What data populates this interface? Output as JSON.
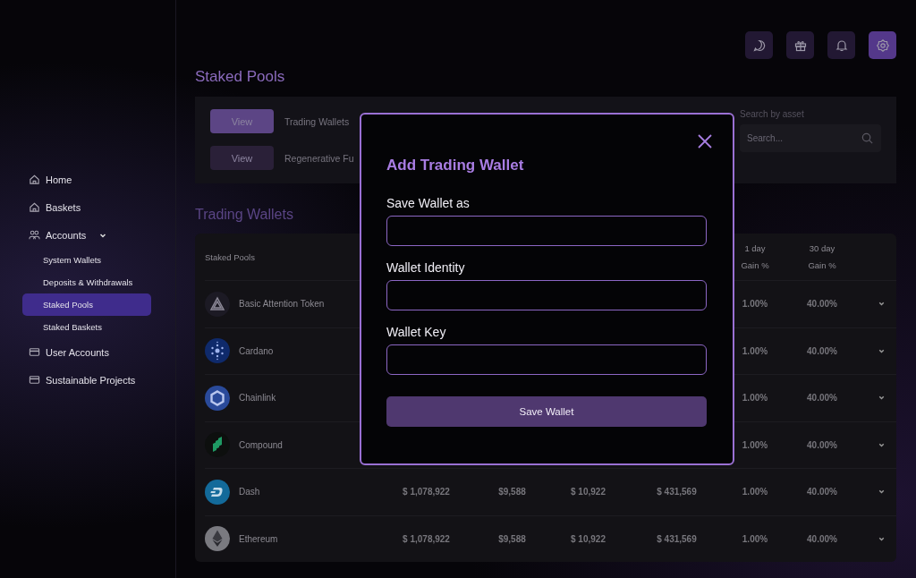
{
  "sidebar": {
    "items": [
      {
        "label": "Home",
        "selected": false
      },
      {
        "label": "Baskets",
        "selected": false
      },
      {
        "label": "Accounts",
        "selected": false,
        "expanded": true,
        "children": [
          {
            "label": "System Wallets",
            "selected": false
          },
          {
            "label": "Deposits & Withdrawals",
            "selected": false
          },
          {
            "label": "Staked Pools",
            "selected": true
          },
          {
            "label": "Staked Baskets",
            "selected": false
          }
        ]
      },
      {
        "label": "User Accounts",
        "selected": false
      },
      {
        "label": "Sustainable Projects",
        "selected": false
      }
    ]
  },
  "toolbar": [
    {
      "selected": false
    },
    {
      "selected": false
    },
    {
      "selected": false
    },
    {
      "selected": true
    }
  ],
  "page_title": "Staked Pools",
  "filters": {
    "pools": [
      {
        "button": "View",
        "label": "Trading Wallets",
        "selected": true
      },
      {
        "button": "View",
        "label": "Regenerative Fu",
        "selected": false
      }
    ],
    "search": {
      "label": "Search by asset",
      "placeholder": "Search..."
    }
  },
  "section_title": "Trading Wallets",
  "table": {
    "columns": [
      {
        "label": "Staked Pools"
      },
      {
        "label": "1 day",
        "sub": "Gain %"
      },
      {
        "label": "30 day",
        "sub": "Gain %"
      }
    ],
    "rows": [
      {
        "name": "Basic Attention Token",
        "gain_1d": "1.00%",
        "gain_30d": "40.00%"
      },
      {
        "name": "Cardano",
        "gain_1d": "1.00%",
        "gain_30d": "40.00%"
      },
      {
        "name": "Chainlink",
        "gain_1d": "1.00%",
        "gain_30d": "40.00%"
      },
      {
        "name": "Compound",
        "gain_1d": "1.00%",
        "gain_30d": "40.00%"
      },
      {
        "name": "Dash",
        "liquidity": "$ 1,078,922",
        "unrealised": "$9,588",
        "realised_1d": "$ 10,922",
        "realised_30d": "$ 431,569",
        "gain_1d": "1.00%",
        "gain_30d": "40.00%"
      },
      {
        "name": "Ethereum",
        "liquidity": "$ 1,078,922",
        "unrealised": "$9,588",
        "realised_1d": "$ 10,922",
        "realised_30d": "$ 431,569",
        "gain_1d": "1.00%",
        "gain_30d": "40.00%"
      }
    ]
  },
  "modal": {
    "title": "Add Trading Wallet",
    "fields": [
      {
        "label": "Save Wallet as"
      },
      {
        "label": "Wallet Identity"
      },
      {
        "label": "Wallet Key"
      }
    ],
    "submit": "Save Wallet"
  }
}
